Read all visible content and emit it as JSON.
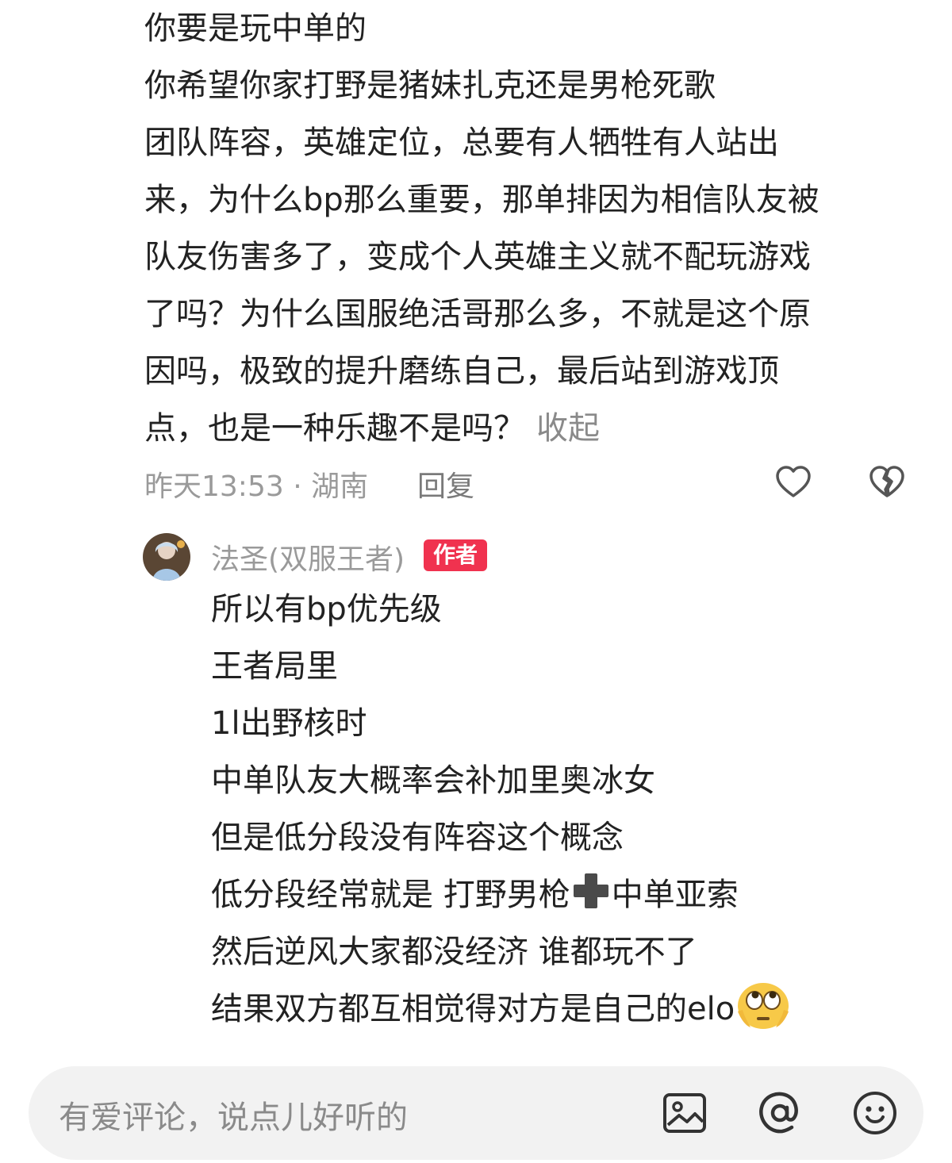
{
  "comment": {
    "lines": [
      "你要是玩中单的",
      "你希望你家打野是猪妹扎克还是男枪死歌",
      "团队阵容，英雄定位，总要有人牺牲有人站出",
      "来，为什么bp那么重要，那单排因为相信队友被",
      "队友伤害多了，变成个人英雄主义就不配玩游戏",
      "了吗？为什么国服绝活哥那么多，不就是这个原",
      "因吗，极致的提升磨练自己，最后站到游戏顶",
      "点，也是一种乐趣不是吗？"
    ],
    "collapse_label": "收起",
    "meta": {
      "time_location": "昨天13:53 · 湖南",
      "reply_label": "回复",
      "like_icon": "heart-outline-icon",
      "dislike_icon": "broken-heart-icon"
    }
  },
  "reply": {
    "username": "法圣(双服王者)",
    "badge": "作者",
    "avatar_icon": "user-avatar",
    "lines": [
      "所以有bp优先级",
      "王者局里",
      "1l出野核时",
      "中单队友大概率会补加里奥冰女",
      "但是低分段没有阵容这个概念"
    ],
    "line6_part1": "低分段经常就是 打野男枪",
    "line6_part2": "中单亚索",
    "line7": "然后逆风大家都没经济 谁都玩不了",
    "line8": "结果双方都互相觉得对方是自己的elo",
    "plus_emoji": "plus-emoji",
    "eyes_emoji": "rolling-eyes-emoji"
  },
  "input_bar": {
    "placeholder": "有爱评论，说点儿好听的",
    "icons": [
      "image-icon",
      "at-icon",
      "emoji-icon"
    ]
  },
  "colors": {
    "text": "#222222",
    "muted": "#9a9a9a",
    "badge": "#f0324f",
    "input_bg": "#f2f2f2"
  }
}
